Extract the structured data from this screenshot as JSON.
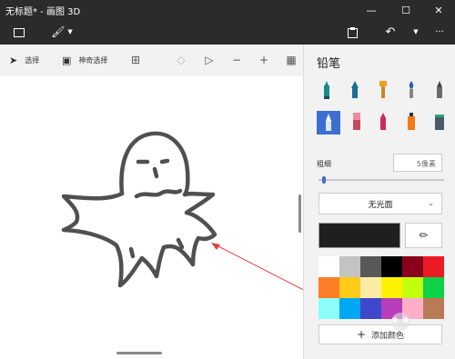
{
  "window": {
    "title": "无标题* - 画图 3D",
    "minimize_icon": "minimize-icon",
    "maximize_icon": "maximize-icon",
    "close_icon": "close-icon"
  },
  "toolbar": {
    "select_label": "选择",
    "magic_select_label": "神奇选择"
  },
  "panel": {
    "title": "铅笔",
    "thickness_label": "粗细",
    "thickness_value": "5像素",
    "thickness_fraction": 0.03,
    "finish_value": "无光面",
    "add_color_label": "添加颜色",
    "current_color": "#1f1f1f",
    "accent_color": "#3d6fd0",
    "palette": [
      "#ffffff",
      "#c3c3c3",
      "#585858",
      "#000000",
      "#88001b",
      "#ec1c24",
      "#ff7f27",
      "#ffca18",
      "#fdeca6",
      "#fff200",
      "#c4ff0e",
      "#0ed145",
      "#8cfffb",
      "#00a8f3",
      "#3f48cc",
      "#b83dba",
      "#ffaec8",
      "#b97a56"
    ]
  }
}
